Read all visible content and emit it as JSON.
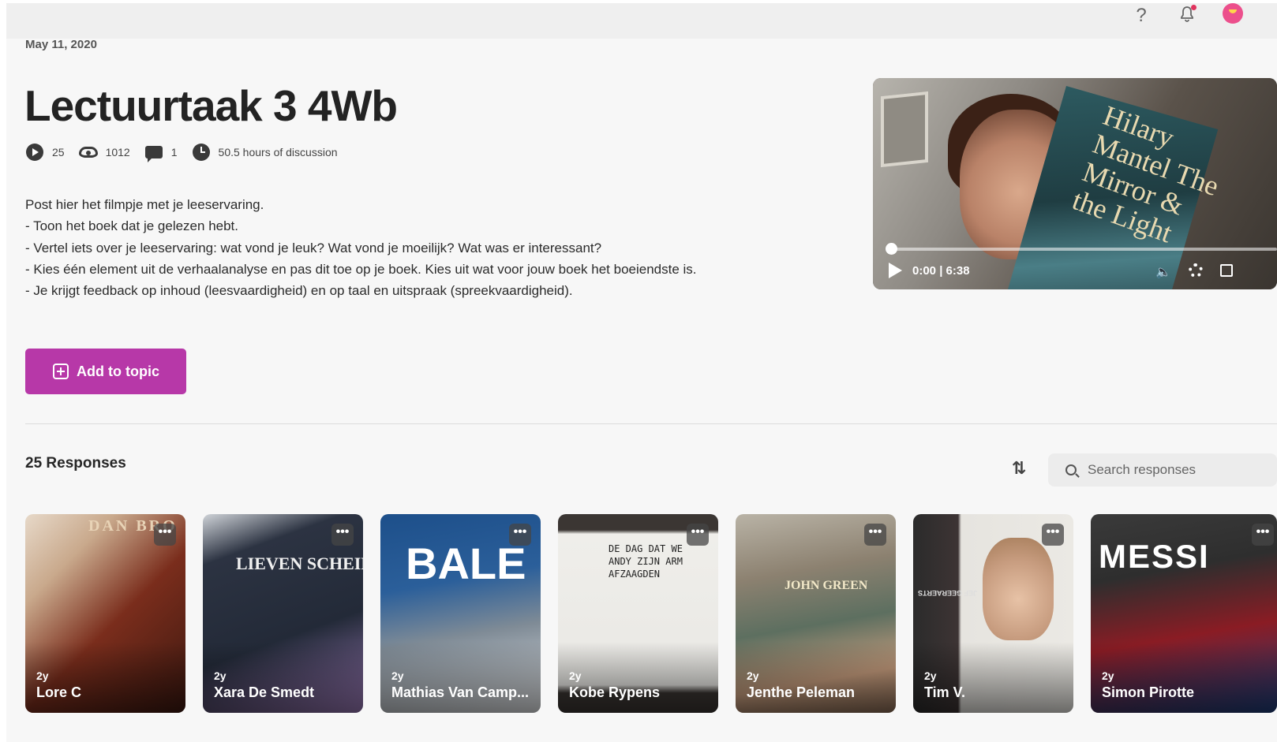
{
  "topbar": {
    "help_label": "?",
    "icons": [
      "help-icon",
      "bell-icon",
      "avatar"
    ],
    "notification_color": "#e0345e"
  },
  "topic": {
    "date": "May 11, 2020",
    "title": "Lectuurtaak 3 4Wb",
    "stats": {
      "videos": "25",
      "views": "1012",
      "comments": "1",
      "discussion": "50.5 hours of discussion"
    },
    "description": [
      "Post hier het filmpje met je leeservaring.",
      "- Toon het boek dat je gelezen hebt.",
      "- Vertel iets over je leeservaring: wat vond je leuk? Wat vond je moeilijk? Wat was er interessant?",
      "- Kies één element uit de verhaalanalyse en pas dit toe op je boek. Kies uit wat voor jouw boek het boeiendste is.",
      "- Je krijgt feedback op inhoud (leesvaardigheid) en op taal en uitspraak (spreekvaardigheid)."
    ],
    "add_button_label": "Add to topic",
    "accent_color": "#b738a8"
  },
  "video": {
    "book_title": "Hilary Mantel The Mirror & the Light",
    "time": "0:00 | 6:38",
    "progress_fraction": 0
  },
  "responses": {
    "count_label": "25 Responses",
    "search_placeholder": "Search responses",
    "sort_icon": "sort-arrows-icon",
    "more_label": "•••",
    "items": [
      {
        "age": "2y",
        "name": "Lore C",
        "cover": "DAN BRO"
      },
      {
        "age": "2y",
        "name": "Xara De Smedt",
        "cover": "LIEVEN SCHEIRE"
      },
      {
        "age": "2y",
        "name": "Mathias Van Camp...",
        "cover": "BALE"
      },
      {
        "age": "2y",
        "name": "Kobe Rypens",
        "cover": "DE DAG DAT WE ANDY ZIJN ARM AFZAAGDEN"
      },
      {
        "age": "2y",
        "name": "Jenthe Peleman",
        "cover": "JOHN GREEN"
      },
      {
        "age": "2y",
        "name": "Tim V.",
        "cover": "JEF GEERAERTS"
      },
      {
        "age": "2y",
        "name": "Simon Pirotte",
        "cover": "MESSI"
      }
    ]
  }
}
